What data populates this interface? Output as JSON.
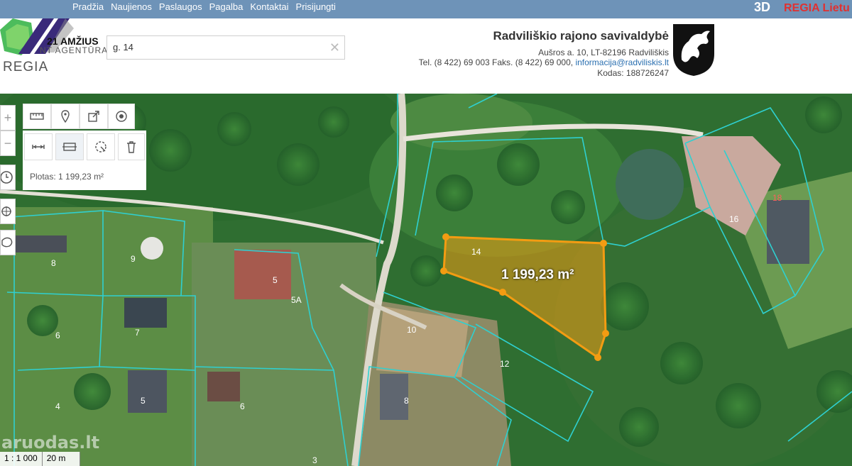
{
  "nav": {
    "items": [
      "Pradžia",
      "Naujienos",
      "Paslaugos",
      "Pagalba",
      "Kontaktai",
      "Prisijungti"
    ],
    "btn_3d": "3D",
    "brand": "REGIA Lietu"
  },
  "logo": {
    "agency_line1": "21 AMŽIUS",
    "agency_line2": "NT AGENTŪRA",
    "regia": "REGIA"
  },
  "search": {
    "value": "g. 14"
  },
  "municipality": {
    "title": "Radviliškio rajono savivaldybė",
    "address": "Aušros a. 10, LT-82196 Radviliškis",
    "phone": "Tel. (8 422) 69 003 Faks. (8 422) 69 000,",
    "email": "informacija@radviliskis.lt",
    "code": "Kodas: 188726247"
  },
  "measure": {
    "area_label": "Plotas: 1 199,23 m²",
    "area_on_map": "1 199,23 m²",
    "color": "#f39c12"
  },
  "parcels": [
    "14",
    "10",
    "12",
    "16",
    "18",
    "8",
    "9",
    "5",
    "5A",
    "6",
    "7",
    "6",
    "5",
    "4",
    "8",
    "6",
    "3"
  ],
  "scale": {
    "ratio": "1 : 1 000",
    "distance": "20 m"
  },
  "watermark": "aruodas.lt",
  "colors": {
    "nav_bg": "#6e93b8",
    "parcel_line": "#2fd0d0",
    "brand_red": "#e03131"
  }
}
